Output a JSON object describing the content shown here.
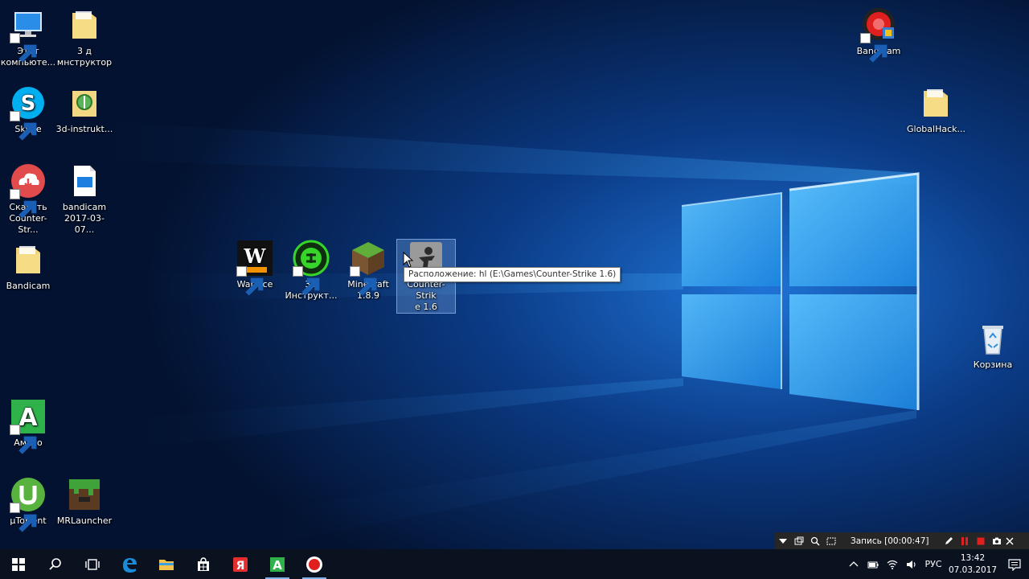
{
  "desktop": {
    "icons": [
      {
        "label": "Этот\nкомпьюте..."
      },
      {
        "label": "3 д\nмнструктор"
      },
      {
        "label": "Skype"
      },
      {
        "label": "3d-instrukt..."
      },
      {
        "label": "Скачать\nCounter-Str..."
      },
      {
        "label": "bandicam\n2017-03-07..."
      },
      {
        "label": "Bandicam"
      },
      {
        "label": "Амиго"
      },
      {
        "label": "µTorrent"
      },
      {
        "label": "MRLauncher"
      },
      {
        "label": "Warface"
      },
      {
        "label": "3D\nИнструкт..."
      },
      {
        "label": "Minecraft\n1.8.9"
      },
      {
        "label": "Counter-Strik\ne 1.6"
      },
      {
        "label": "Bandicam"
      },
      {
        "label": "GlobalHack..."
      },
      {
        "label": "Корзина"
      }
    ],
    "tooltip": "Расположение: hl (E:\\Games\\Counter-Strike 1.6)"
  },
  "bandicam_bar": {
    "recording": "Запись [00:00:47]"
  },
  "taskbar": {
    "apps": [
      "start-icon",
      "search-icon",
      "task-view-icon",
      "edge-icon",
      "file-explorer-icon",
      "store-icon",
      "yandex-icon",
      "amigo-icon",
      "bandicam-icon"
    ],
    "tray": {
      "language": "РУС",
      "time": "13:42",
      "date": "07.03.2017"
    }
  },
  "colors": {
    "taskbar_bg": "#0a1220",
    "wallpaper_dark": "#041a3c",
    "wallpaper_light": "#4fb6ff",
    "bandicam_bar_bg": "#262626",
    "record_red": "#e0201f"
  }
}
